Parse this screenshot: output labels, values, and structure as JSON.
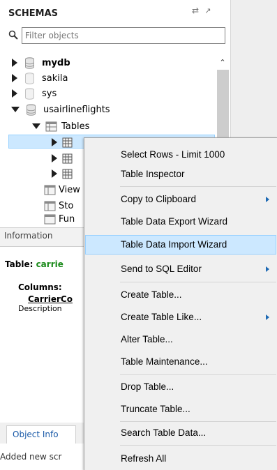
{
  "navigator": {
    "title": "SCHEMAS",
    "filter_placeholder": "Filter objects",
    "schemas": [
      {
        "name": "mydb",
        "bold": true,
        "expanded": false
      },
      {
        "name": "sakila",
        "bold": false,
        "expanded": false
      },
      {
        "name": "sys",
        "bold": false,
        "expanded": false
      },
      {
        "name": "usairlineflights",
        "bold": false,
        "expanded": true
      }
    ],
    "tables_node": "Tables",
    "views_partial": "View",
    "procs_partial": "Sto",
    "funcs_partial": "Fun"
  },
  "info_panel": {
    "header": "Information",
    "table_prefix": "Table: ",
    "table_name": "carrie",
    "columns_label": "Columns:",
    "first_column": "CarrierCo",
    "description_label": "Description",
    "tab": "Object Info",
    "output_text": "Added new scr"
  },
  "context_menu": {
    "highlighted_index": 4,
    "items": [
      {
        "label": "Select Rows - Limit 1000",
        "submenu": false
      },
      {
        "label": "Table Inspector",
        "submenu": false
      },
      {
        "label": "Copy to Clipboard",
        "submenu": true
      },
      {
        "label": "Table Data Export Wizard",
        "submenu": false
      },
      {
        "label": "Table Data Import Wizard",
        "submenu": false
      },
      {
        "label": "Send to SQL Editor",
        "submenu": true
      },
      {
        "label": "Create Table...",
        "submenu": false
      },
      {
        "label": "Create Table Like...",
        "submenu": true
      },
      {
        "label": "Alter Table...",
        "submenu": false
      },
      {
        "label": "Table Maintenance...",
        "submenu": false
      },
      {
        "label": "Drop Table...",
        "submenu": false
      },
      {
        "label": "Truncate Table...",
        "submenu": false
      },
      {
        "label": "Search Table Data...",
        "submenu": false
      },
      {
        "label": "Refresh All",
        "submenu": false
      }
    ]
  },
  "colors": {
    "selection_bg": "#cce8ff",
    "selection_border": "#99d1ff",
    "menu_bg": "#f0f0f0",
    "table_name": "#1a8a1a",
    "submenu_arrow": "#1e6ab4"
  },
  "icons": [
    "search-icon",
    "database-icon",
    "folder-icon",
    "table-icon",
    "chevron-right-icon"
  ]
}
